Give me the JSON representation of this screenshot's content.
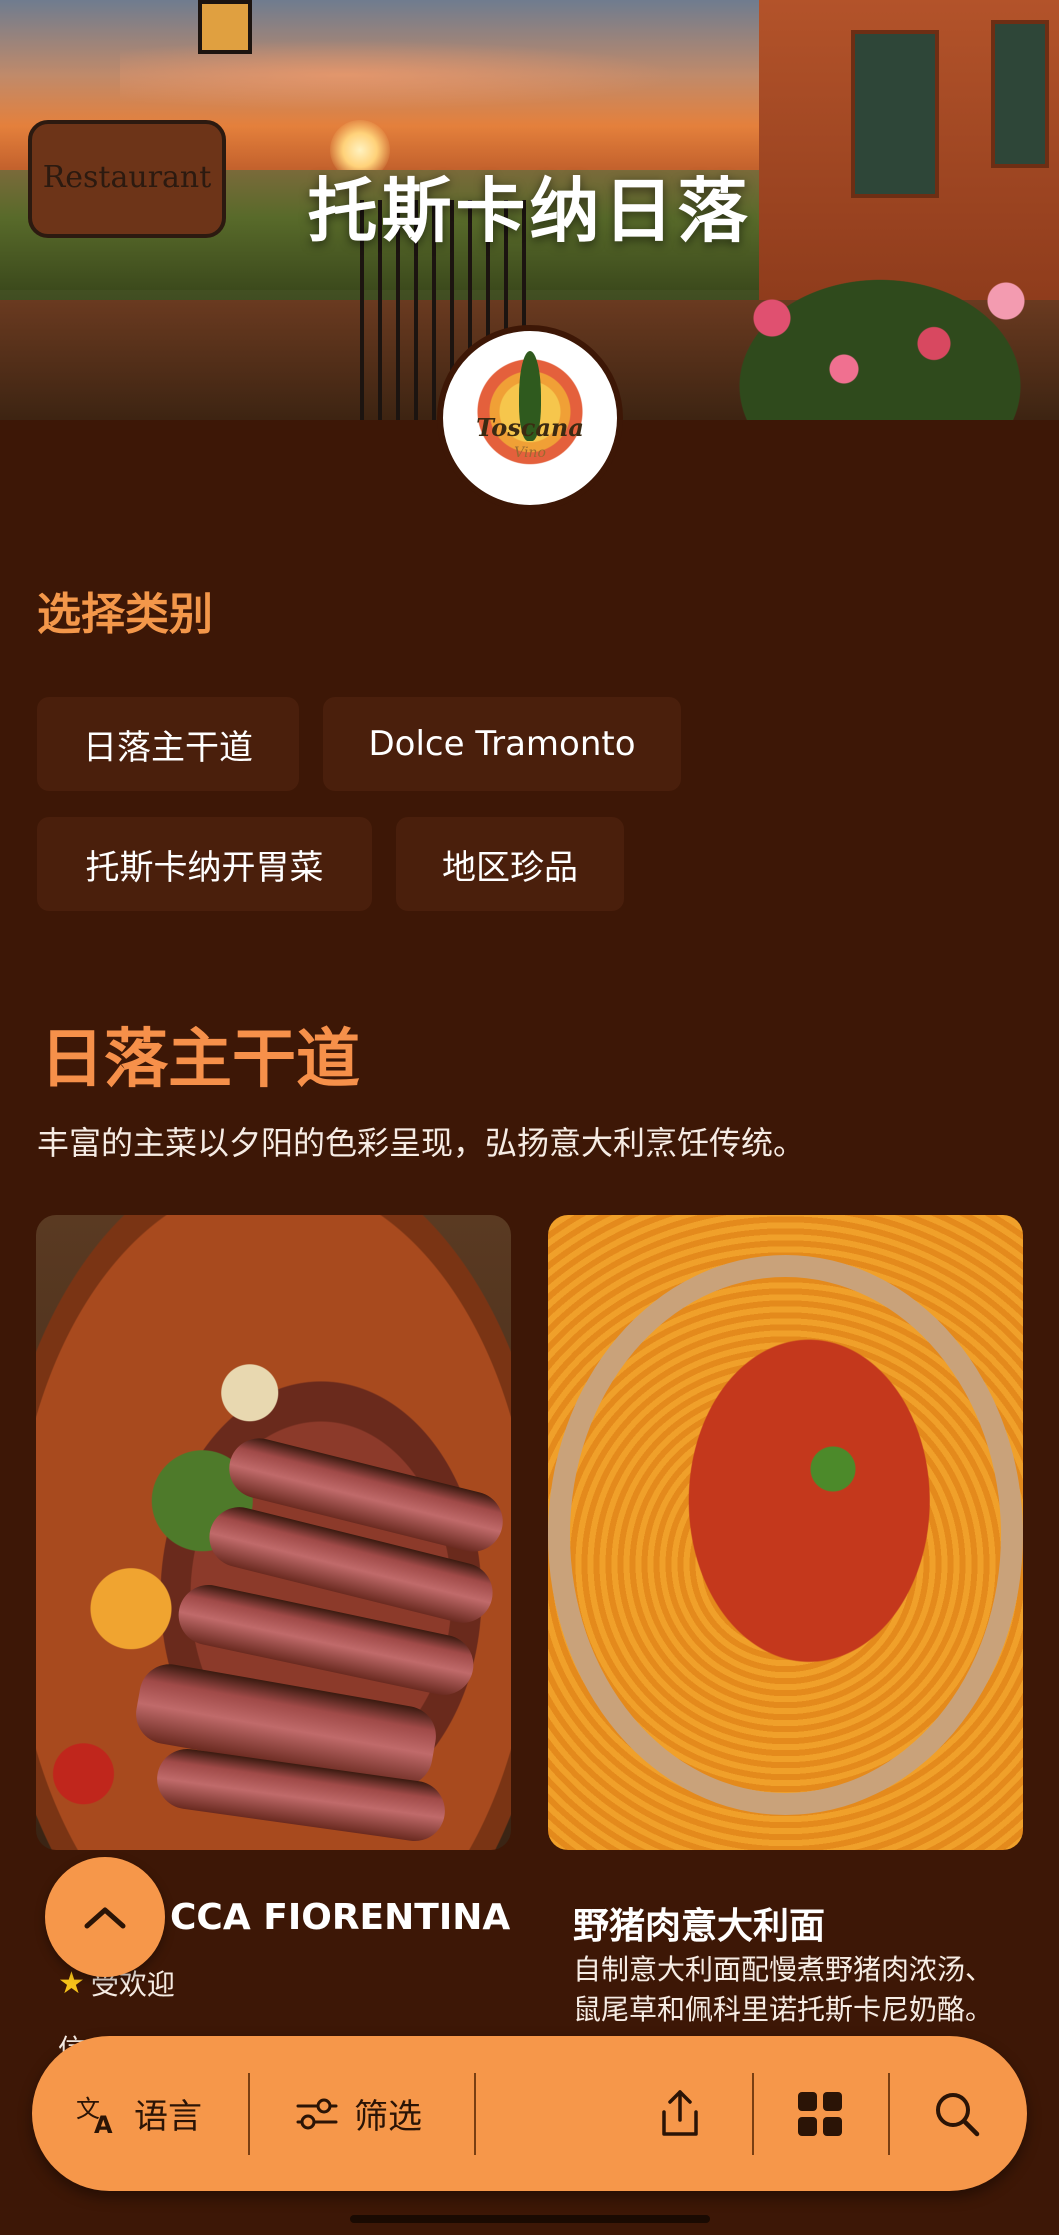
{
  "hero": {
    "title": "托斯卡纳日落",
    "sign_text": "Restaurant"
  },
  "logo": {
    "name": "Toscana",
    "sub": "Vino"
  },
  "categories": {
    "label": "选择类别",
    "items": [
      "日落主干道",
      "Dolce Tramonto",
      "托斯卡纳开胃菜",
      "地区珍品"
    ]
  },
  "section": {
    "title": "日落主干道",
    "description": "丰富的主菜以夕阳的色彩呈现，弘扬意大利烹饪传统。"
  },
  "dishes": [
    {
      "name": "BISTECCA FIORENTINA",
      "visible_name": "CCA FIORENTINA",
      "badge": "受欢迎",
      "price_peek": "信"
    },
    {
      "name": "野猪肉意大利面",
      "description": "自制意大利面配慢煮野猪肉浓汤、鼠尾草和佩科里诺托斯卡尼奶酪。"
    }
  ],
  "bottom_bar": {
    "language_label": "语言",
    "filter_label": "筛选"
  },
  "icons": [
    "translate-icon",
    "filter-icon",
    "share-icon",
    "grid-icon",
    "search-icon",
    "chevron-up-icon"
  ],
  "colors": {
    "background": "#3d1706",
    "accent": "#f6974a",
    "chip": "#4a1f0c",
    "title": "#f6904a"
  }
}
